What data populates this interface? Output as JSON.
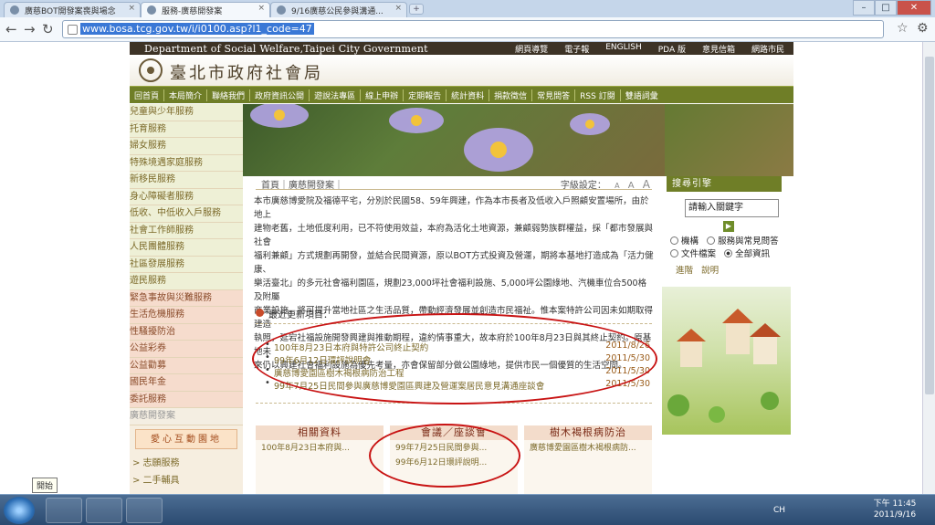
{
  "browser": {
    "tabs": [
      {
        "title": "廣慈BOT開發案喪與場念"
      },
      {
        "title": "服務-廣慈開發案"
      },
      {
        "title": "9/16廣慈公民參與溝通..."
      }
    ],
    "url": "www.bosa.tcg.gov.tw/i/i0100.asp?l1_code=47"
  },
  "site": {
    "dept_en": "Department of Social Welfare,Taipei City Government",
    "bureau": "臺北市政府社會局",
    "top_links": [
      "網頁導覽",
      "電子報",
      "ENGLISH",
      "PDA 版",
      "意見信箱",
      "網路市民"
    ],
    "main_nav": [
      "回首頁",
      "本局簡介",
      "聯絡我們",
      "政府資訊公開",
      "遊說法專區",
      "線上申辦",
      "定期報告",
      "統計資料",
      "捐款徵信",
      "常見問答",
      "RSS 訂閱",
      "雙語詞彙"
    ],
    "sidebar": [
      {
        "label": "兒童與少年服務",
        "style": "normal"
      },
      {
        "label": "托育服務",
        "style": "normal"
      },
      {
        "label": "婦女服務",
        "style": "normal"
      },
      {
        "label": "特殊境遇家庭服務",
        "style": "normal"
      },
      {
        "label": "新移民服務",
        "style": "normal"
      },
      {
        "label": "身心障礙者服務",
        "style": "normal"
      },
      {
        "label": "低收、中低收入戶服務",
        "style": "normal"
      },
      {
        "label": "社會工作師服務",
        "style": "normal"
      },
      {
        "label": "人民團體服務",
        "style": "normal"
      },
      {
        "label": "社區發展服務",
        "style": "normal"
      },
      {
        "label": "遊民服務",
        "style": "normal"
      },
      {
        "label": "緊急事故與災難服務",
        "style": "alt"
      },
      {
        "label": "生活危機服務",
        "style": "alt"
      },
      {
        "label": "性騷擾防治",
        "style": "alt"
      },
      {
        "label": "公益彩券",
        "style": "alt"
      },
      {
        "label": "公益勸募",
        "style": "alt"
      },
      {
        "label": "國民年金",
        "style": "alt"
      },
      {
        "label": "委託服務",
        "style": "alt"
      },
      {
        "label": "廣慈開發案",
        "style": "gray"
      }
    ],
    "love_bar": "愛心互動園地",
    "sub_links": [
      "> 志願服務",
      "> 二手輔具"
    ],
    "breadcrumb": "首頁｜廣慈開發案｜",
    "font_label": "字級設定：",
    "font_sizes": [
      "A",
      "A",
      "A"
    ],
    "article": "本市廣慈博愛院及福德平宅，分別於民國58、59年興建，作為本市長者及低收入戶照顧安置場所，由於地上\n建物老舊，土地低度利用，已不符使用效益，本府為活化土地資源，兼顧弱勢族群權益，採「都市發展與社會\n福利兼顧」方式規劃再開發，並結合民間資源，原以BOT方式投資及營運，期將本基地打造成為「活力健康、\n樂活臺北」的多元社會福利園區，規劃23,000坪社會福利設施、5,000坪公園綠地、汽機車位合500格及附屬\n商業設施，將可提升當地社區之生活品質，帶動經濟發展並創造市民福祉。惟本案特許公司因未如期取得建造\n執照，延宕社福設施開發興建與推動期程，違約情事重大，故本府於100年8月23日與其終止契約。原基地未\n來仍以興建社會福利設施為優先考量，亦會保留部分做公園綠地，提供市民一個優質的生活空間。",
    "updates_title": "最近更新項目：",
    "updates": [
      {
        "text": "100年8月23日本府與特許公司終止契約",
        "date": "2011/8/26"
      },
      {
        "text": "99年6月12日環評說明會",
        "date": "2011/5/30"
      },
      {
        "text": "廣慈博愛園區樹木褐根病防治工程",
        "date": "2011/5/30"
      },
      {
        "text": "99年7月25日民間參與廣慈博愛園區興建及營運案居民意見溝通座談會",
        "date": "2011/5/30"
      }
    ],
    "boxes": [
      {
        "title": "相關資料",
        "items": [
          "100年8月23日本府與..."
        ]
      },
      {
        "title": "會議／座談會",
        "items": [
          "99年7月25日民間參與...",
          "99年6月12日環評說明..."
        ]
      },
      {
        "title": "樹木褐根病防治",
        "items": [
          "廣慈博愛園區樹木褐根病防..."
        ]
      }
    ],
    "guide": {
      "title": "搜尋引擎",
      "input_value": "請輸入關鍵字",
      "go": "▶",
      "options": [
        {
          "label": "機構",
          "checked": false
        },
        {
          "label": "服務與常見問答",
          "checked": false
        },
        {
          "label": "文件檔案",
          "checked": false
        },
        {
          "label": "全部資訊",
          "checked": true
        }
      ],
      "links": [
        "進階",
        "說明"
      ]
    }
  },
  "os": {
    "tooltip": "開始",
    "ime": "CH",
    "time": "下午 11:45",
    "date": "2011/9/16"
  },
  "colors": {
    "nav_green": "#6f7e27",
    "annotation_red": "#c81414",
    "top_strip": "#3d3326"
  }
}
